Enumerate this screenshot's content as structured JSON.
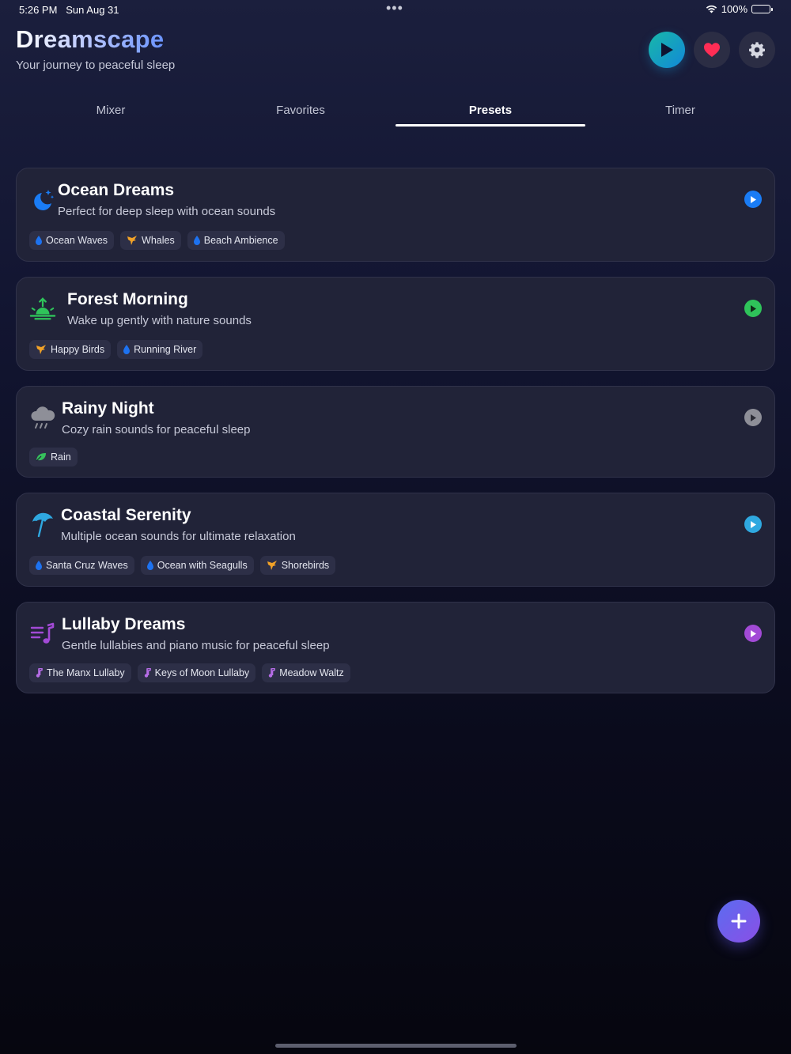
{
  "status_bar": {
    "time": "5:26 PM",
    "date": "Sun Aug 31",
    "battery": "100%"
  },
  "header": {
    "title": "Dreamscape",
    "subtitle": "Your journey to peaceful sleep"
  },
  "tabs": [
    {
      "label": "Mixer",
      "active": false
    },
    {
      "label": "Favorites",
      "active": false
    },
    {
      "label": "Presets",
      "active": true
    },
    {
      "label": "Timer",
      "active": false
    }
  ],
  "presets": [
    {
      "title": "Ocean Dreams",
      "description": "Perfect for deep sleep with ocean sounds",
      "icon": "moon-stars-icon",
      "accent": "#1a7cf5",
      "sounds": [
        {
          "label": "Ocean Waves",
          "icon": "drop-icon"
        },
        {
          "label": "Whales",
          "icon": "bird-icon"
        },
        {
          "label": "Beach Ambience",
          "icon": "drop-icon"
        }
      ]
    },
    {
      "title": "Forest Morning",
      "description": "Wake up gently with nature sounds",
      "icon": "sunrise-icon",
      "accent": "#2fc35a",
      "sounds": [
        {
          "label": "Happy Birds",
          "icon": "bird-icon"
        },
        {
          "label": "Running River",
          "icon": "drop-icon"
        }
      ]
    },
    {
      "title": "Rainy Night",
      "description": "Cozy rain sounds for peaceful sleep",
      "icon": "cloud-rain-icon",
      "accent": "#8e8f98",
      "sounds": [
        {
          "label": "Rain",
          "icon": "leaf-icon"
        }
      ]
    },
    {
      "title": "Coastal Serenity",
      "description": "Multiple ocean sounds for ultimate relaxation",
      "icon": "beach-umbrella-icon",
      "accent": "#2fa8e0",
      "sounds": [
        {
          "label": "Santa Cruz Waves",
          "icon": "drop-icon"
        },
        {
          "label": "Ocean with Seagulls",
          "icon": "drop-icon"
        },
        {
          "label": "Shorebirds",
          "icon": "bird-icon"
        }
      ]
    },
    {
      "title": "Lullaby Dreams",
      "description": "Gentle lullabies and piano music for peaceful sleep",
      "icon": "music-list-icon",
      "accent": "#a24ad6",
      "sounds": [
        {
          "label": "The Manx Lullaby",
          "icon": "music-note-icon"
        },
        {
          "label": "Keys of Moon Lullaby",
          "icon": "music-note-icon"
        },
        {
          "label": "Meadow Waltz",
          "icon": "music-note-icon"
        }
      ]
    }
  ],
  "colors": {
    "drop": "#1d72f0",
    "bird": "#f2a227",
    "leaf": "#36c15c",
    "note": "#b56ce6",
    "favorite": "#ff2d55"
  }
}
